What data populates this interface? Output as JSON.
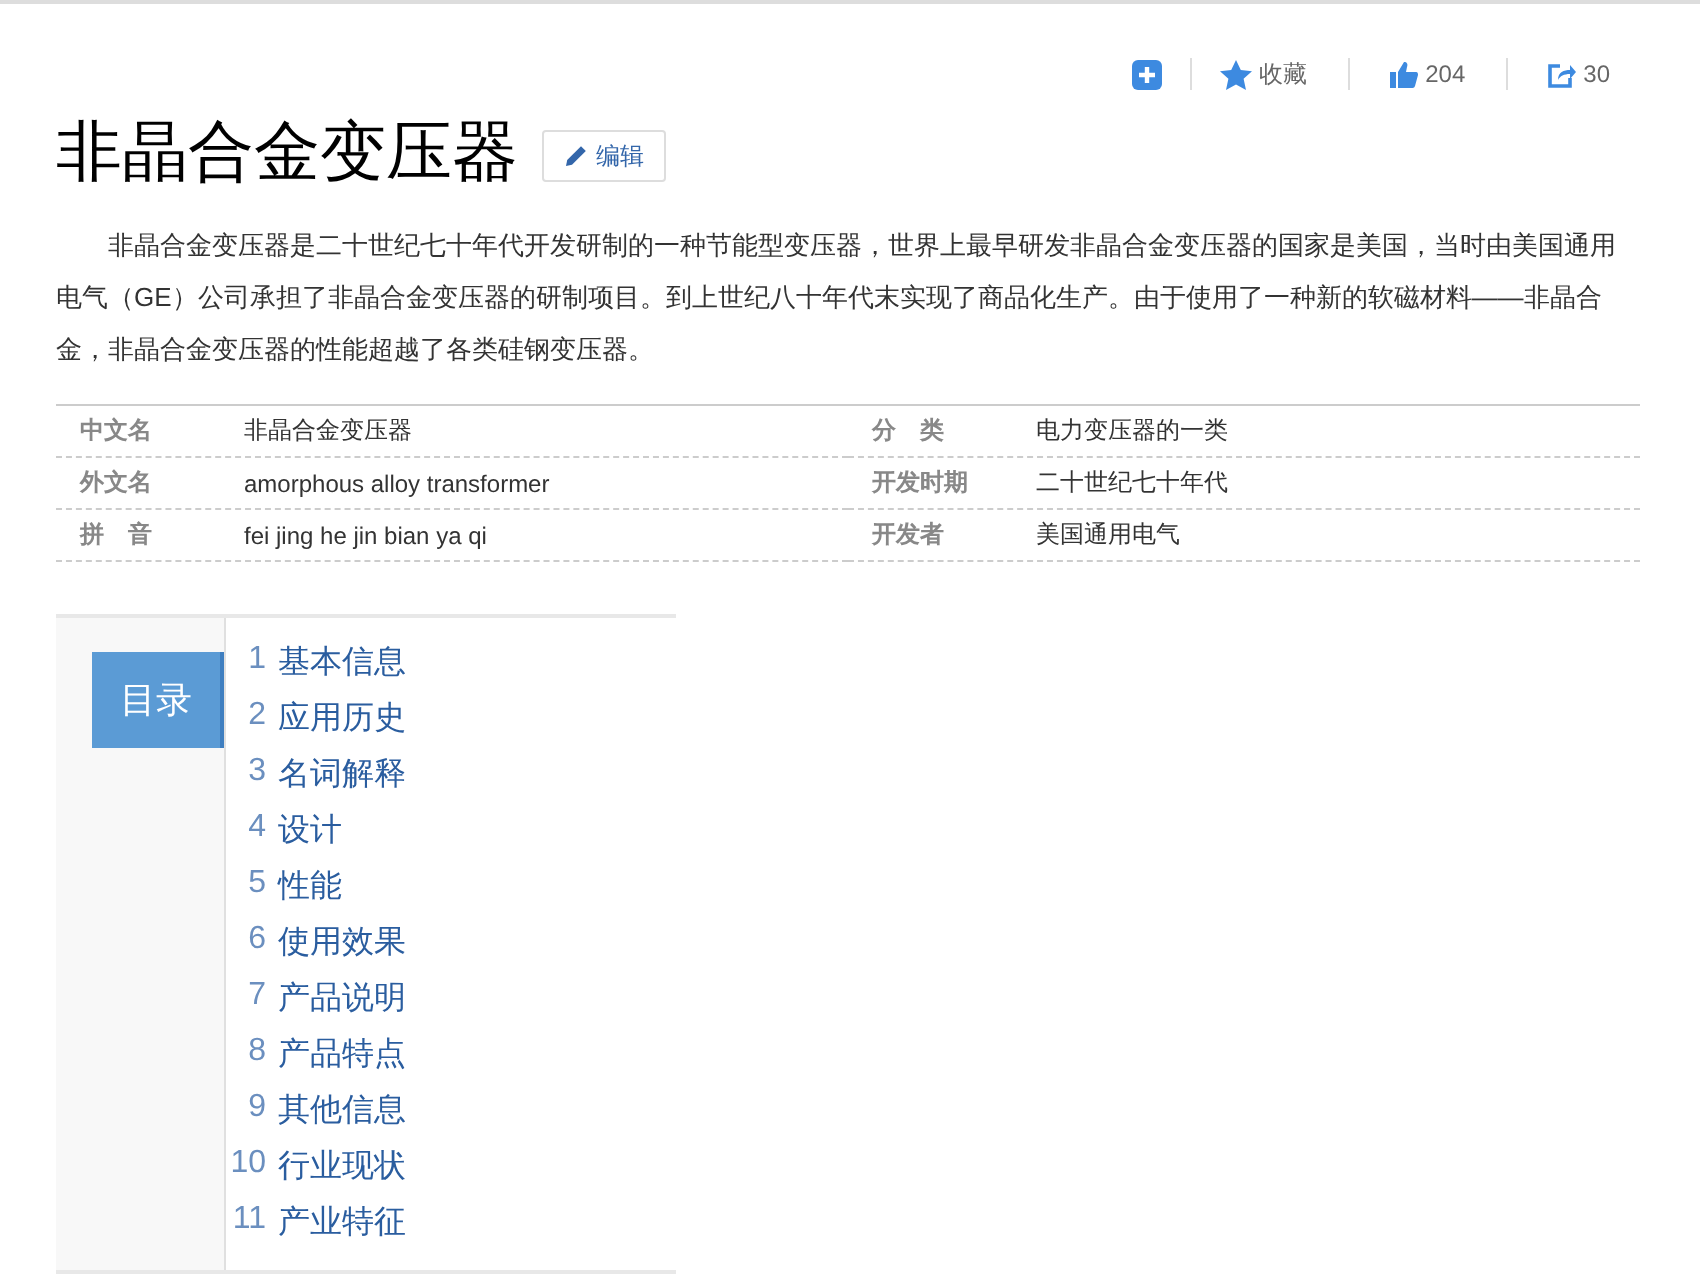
{
  "toolbar": {
    "collect_label": "收藏",
    "likes": "204",
    "shares": "30"
  },
  "title": "非晶合金变压器",
  "edit_label": "编辑",
  "summary": "非晶合金变压器是二十世纪七十年代开发研制的一种节能型变压器，世界上最早研发非晶合金变压器的国家是美国，当时由美国通用电气（GE）公司承担了非晶合金变压器的研制项目。到上世纪八十年代末实现了商品化生产。由于使用了一种新的软磁材料——非晶合金，非晶合金变压器的性能超越了各类硅钢变压器。",
  "basic_info": [
    {
      "label": "中文名",
      "value": "非晶合金变压器"
    },
    {
      "label": "分　类",
      "value": "电力变压器的一类"
    },
    {
      "label": "外文名",
      "value": "amorphous alloy transformer"
    },
    {
      "label": "开发时期",
      "value": "二十世纪七十年代"
    },
    {
      "label": "拼　音",
      "value": "fei jing he jin bian ya qi"
    },
    {
      "label": "开发者",
      "value": "美国通用电气"
    }
  ],
  "catalog": {
    "heading": "目录",
    "items": [
      {
        "number": "1",
        "label": "基本信息"
      },
      {
        "number": "2",
        "label": "应用历史"
      },
      {
        "number": "3",
        "label": "名词解释"
      },
      {
        "number": "4",
        "label": "设计"
      },
      {
        "number": "5",
        "label": "性能"
      },
      {
        "number": "6",
        "label": "使用效果"
      },
      {
        "number": "7",
        "label": "产品说明"
      },
      {
        "number": "8",
        "label": "产品特点"
      },
      {
        "number": "9",
        "label": "其他信息"
      },
      {
        "number": "10",
        "label": "行业现状"
      },
      {
        "number": "11",
        "label": "产业特征"
      }
    ]
  }
}
